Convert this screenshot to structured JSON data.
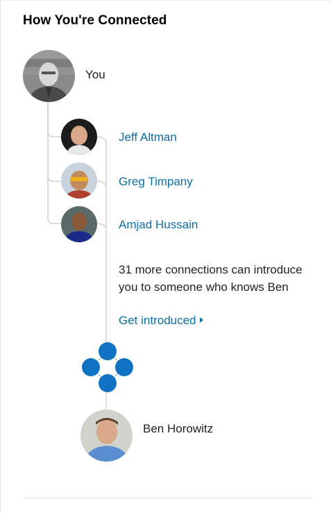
{
  "title": "How You're Connected",
  "you": {
    "label": "You"
  },
  "connections": [
    {
      "name": "Jeff Altman"
    },
    {
      "name": "Greg Timpany"
    },
    {
      "name": "Amjad Hussain"
    }
  ],
  "more": {
    "text": "31 more connections can introduce you to someone who knows Ben",
    "link_label": "Get introduced"
  },
  "target": {
    "name": "Ben Horowitz"
  },
  "colors": {
    "link": "#0b6fa8",
    "network_icon": "#0f72c3",
    "connector": "#d2d2d2"
  },
  "icons": {
    "network": "network-nodes-icon",
    "arrow": "caret-right-icon"
  }
}
